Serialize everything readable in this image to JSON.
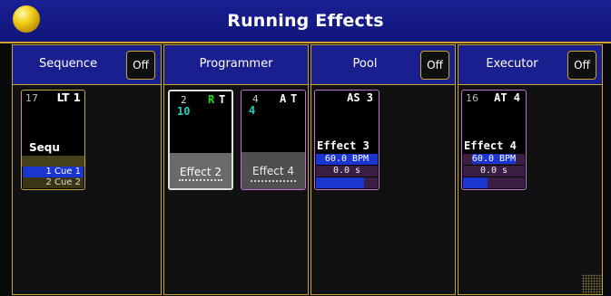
{
  "window": {
    "title": "Running Effects"
  },
  "columns": {
    "sequence": {
      "label": "Sequence",
      "off_label": "Off"
    },
    "programmer": {
      "label": "Programmer"
    },
    "pool": {
      "label": "Pool",
      "off_label": "Off"
    },
    "executor": {
      "label": "Executor",
      "off_label": "Off"
    }
  },
  "sequence_card": {
    "number": "17",
    "header": "LT 1",
    "name": "Sequ",
    "cues": [
      "1 Cue 1",
      "2 Cue 2"
    ]
  },
  "programmer_cards": [
    {
      "number": "2",
      "letter1": "R",
      "letter2": "T",
      "id": "10",
      "name": "Effect 2",
      "selected": true
    },
    {
      "number": "4",
      "letter1": "A",
      "letter2": "T",
      "id": "4",
      "name": "Effect 4",
      "selected": false
    }
  ],
  "pool_card": {
    "header": "AS 3",
    "name": "Effect 3",
    "bpm": "60.0 BPM",
    "time": "0.0 s",
    "progress": 0.78
  },
  "executor_card": {
    "number": "16",
    "header": "AT 4",
    "name": "Effect 4",
    "bpm": "60.0 BPM",
    "time": "0.0 s",
    "progress": 0.4
  },
  "colors": {
    "title_bar": "#1a1f93",
    "border_gold": "#c9a534",
    "cue_active": "#1a35d0",
    "programmer_id_teal": "#1fd0c0",
    "letter_green": "#22dd22",
    "pool_card_border": "#c070d0"
  }
}
